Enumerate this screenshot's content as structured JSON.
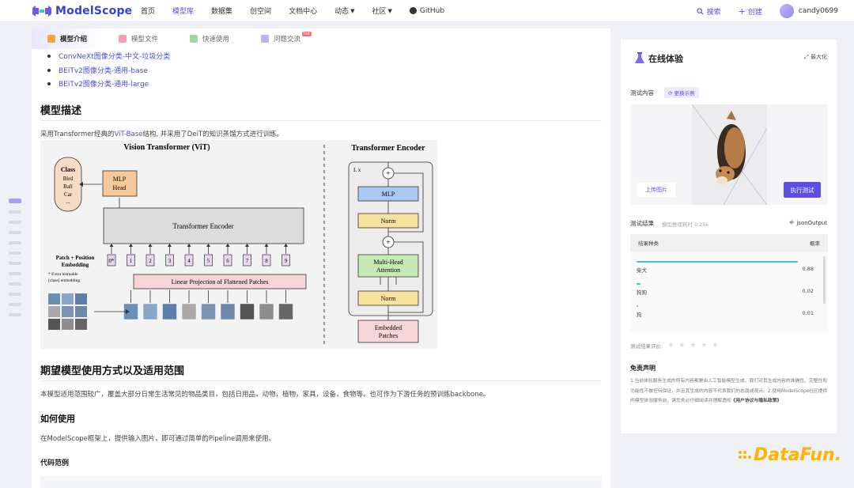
{
  "nav": {
    "logo": "ModelScope",
    "items": [
      {
        "label": "首页",
        "caret": false
      },
      {
        "label": "模型库",
        "caret": false
      },
      {
        "label": "数据集",
        "caret": false
      },
      {
        "label": "创空间",
        "caret": false
      },
      {
        "label": "文档中心",
        "caret": false
      },
      {
        "label": "动态",
        "caret": true
      },
      {
        "label": "社区",
        "caret": true
      },
      {
        "label": "GitHub",
        "caret": false
      }
    ],
    "active_index": 1,
    "search": "搜索",
    "create": "创建",
    "username": "candy0699",
    "accent": "#5c4ee5"
  },
  "subtabs": [
    {
      "label": "模型介绍"
    },
    {
      "label": "模型文件"
    },
    {
      "label": "快速使用"
    },
    {
      "label": "问题交流",
      "badge": "hot"
    }
  ],
  "content": {
    "links": [
      "ConvNeXt图像分类-中文-垃圾分类",
      "BEiTv2图像分类-通用-base",
      "BEiTv2图像分类-通用-large"
    ],
    "desc_title": "模型描述",
    "desc_prefix": "采用Transformer经典的",
    "desc_link": "ViT-Base",
    "desc_suffix": "结构, 并采用了DeiT的知识蒸馏方式进行训练。",
    "use_title": "期望模型使用方式以及适用范围",
    "use_text": "本模型适用范围较广，覆盖大部分日常生活常见的物品类目，包括日用品，动物，植物，家具，设备，食物等。也可作为下游任务的预训练backbone。",
    "how_title": "如何使用",
    "how_text": "在ModelScope框架上，提供输入图片，即可通过简单的Pipeline调用来使用。",
    "code_label": "代码范例"
  },
  "figure": {
    "vit_title": "Vision Transformer (ViT)",
    "enc_title": "Transformer Encoder",
    "class_label": "Class",
    "class_items": [
      "Bird",
      "Ball",
      "Car",
      "..."
    ],
    "mlp_head": [
      "MLP",
      "Head"
    ],
    "encoder": "Transformer Encoder",
    "patch_embed": [
      "Patch + Position",
      "Embedding"
    ],
    "extra_note": [
      "* Extra learnable",
      "[class] embedding"
    ],
    "linear_proj": "Linear Projection of Flattened Patches",
    "tokens": [
      "0*",
      "1",
      "2",
      "3",
      "4",
      "5",
      "6",
      "7",
      "8",
      "9"
    ],
    "lx": "L x",
    "mlp": "MLP",
    "norm": "Norm",
    "mha": [
      "Multi-Head",
      "Attention"
    ],
    "embedded": [
      "Embedded",
      "Patches"
    ],
    "plus": "+"
  },
  "panel": {
    "title": "在线体验",
    "maximize": "最大化",
    "test_content": "测试内容",
    "change_example": "更换示例",
    "upload": "上传图片",
    "run": "执行测试",
    "results_label": "测试结果",
    "elapsed": "模型推理耗时 0.25s",
    "json_output": "jsonOutput",
    "col_type": "结果种类",
    "col_score": "概率",
    "results": [
      {
        "name": "柴犬",
        "score": "0.88"
      },
      {
        "name": "狗狗",
        "score": "0.02"
      },
      {
        "name": "狗",
        "score": "0.01"
      }
    ],
    "rating_label": "测试结果评价:",
    "disclaimer_title": "免责声明",
    "disclaimer_text": "1.当前体验服务生成的所有内容都是由人工智能模型生成，我们对其生成内容的准确性、完整性和功能性不做任何保证，并且其生成的内容不代表我们的态度或观点。2.使用ModelScope社区提供的模型体验服务前，请您务必仔细阅读并理解透彻",
    "disclaimer_link": "《用户协议与隐私政策》"
  },
  "watermark": "DataFun."
}
